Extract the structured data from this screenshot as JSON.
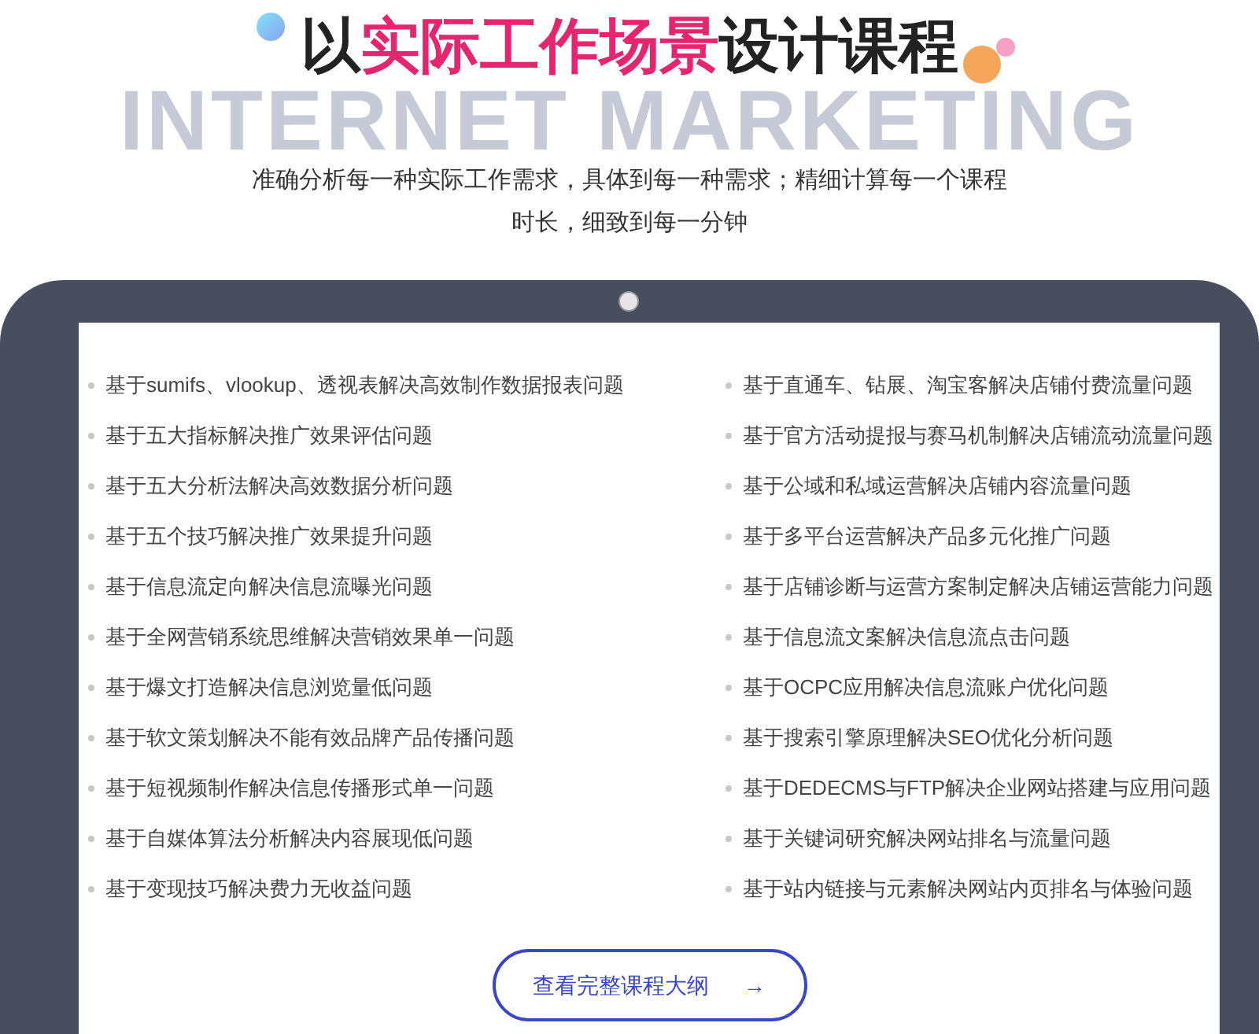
{
  "background_text": "INTERNET MARKETING",
  "title": [
    {
      "text": "以",
      "highlight": false
    },
    {
      "text": "实际工作场景",
      "highlight": true
    },
    {
      "text": "设计课程",
      "highlight": false
    }
  ],
  "subtitle": "准确分析每一种实际工作需求，具体到每一种需求；精细计算每一个课程时长，细致到每一分钟",
  "course_list": {
    "left": [
      "基于sumifs、vlookup、透视表解决高效制作数据报表问题",
      "基于五大指标解决推广效果评估问题",
      "基于五大分析法解决高效数据分析问题",
      "基于五个技巧解决推广效果提升问题",
      "基于信息流定向解决信息流曝光问题",
      "基于全网营销系统思维解决营销效果单一问题",
      "基于爆文打造解决信息浏览量低问题",
      "基于软文策划解决不能有效品牌产品传播问题",
      "基于短视频制作解决信息传播形式单一问题",
      "基于自媒体算法分析解决内容展现低问题",
      "基于变现技巧解决费力无收益问题"
    ],
    "right": [
      "基于直通车、钻展、淘宝客解决店铺付费流量问题",
      "基于官方活动提报与赛马机制解决店铺流动流量问题",
      "基于公域和私域运营解决店铺内容流量问题",
      "基于多平台运营解决产品多元化推广问题",
      "基于店铺诊断与运营方案制定解决店铺运营能力问题",
      "基于信息流文案解决信息流点击问题",
      "基于OCPC应用解决信息流账户优化问题",
      "基于搜索引擎原理解决SEO优化分析问题",
      "基于DEDECMS与FTP解决企业网站搭建与应用问题",
      "基于关键词研究解决网站排名与流量问题",
      "基于站内链接与元素解决网站内页排名与体验问题"
    ]
  },
  "button": {
    "label": "查看完整课程大纲",
    "arrow": "→"
  }
}
